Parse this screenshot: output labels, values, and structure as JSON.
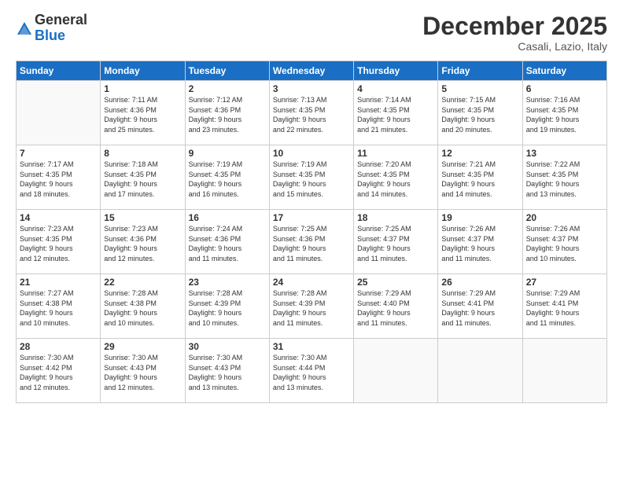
{
  "logo": {
    "general": "General",
    "blue": "Blue"
  },
  "title": "December 2025",
  "location": "Casali, Lazio, Italy",
  "weekdays": [
    "Sunday",
    "Monday",
    "Tuesday",
    "Wednesday",
    "Thursday",
    "Friday",
    "Saturday"
  ],
  "weeks": [
    [
      {
        "day": "",
        "info": ""
      },
      {
        "day": "1",
        "info": "Sunrise: 7:11 AM\nSunset: 4:36 PM\nDaylight: 9 hours\nand 25 minutes."
      },
      {
        "day": "2",
        "info": "Sunrise: 7:12 AM\nSunset: 4:36 PM\nDaylight: 9 hours\nand 23 minutes."
      },
      {
        "day": "3",
        "info": "Sunrise: 7:13 AM\nSunset: 4:35 PM\nDaylight: 9 hours\nand 22 minutes."
      },
      {
        "day": "4",
        "info": "Sunrise: 7:14 AM\nSunset: 4:35 PM\nDaylight: 9 hours\nand 21 minutes."
      },
      {
        "day": "5",
        "info": "Sunrise: 7:15 AM\nSunset: 4:35 PM\nDaylight: 9 hours\nand 20 minutes."
      },
      {
        "day": "6",
        "info": "Sunrise: 7:16 AM\nSunset: 4:35 PM\nDaylight: 9 hours\nand 19 minutes."
      }
    ],
    [
      {
        "day": "7",
        "info": "Sunrise: 7:17 AM\nSunset: 4:35 PM\nDaylight: 9 hours\nand 18 minutes."
      },
      {
        "day": "8",
        "info": "Sunrise: 7:18 AM\nSunset: 4:35 PM\nDaylight: 9 hours\nand 17 minutes."
      },
      {
        "day": "9",
        "info": "Sunrise: 7:19 AM\nSunset: 4:35 PM\nDaylight: 9 hours\nand 16 minutes."
      },
      {
        "day": "10",
        "info": "Sunrise: 7:19 AM\nSunset: 4:35 PM\nDaylight: 9 hours\nand 15 minutes."
      },
      {
        "day": "11",
        "info": "Sunrise: 7:20 AM\nSunset: 4:35 PM\nDaylight: 9 hours\nand 14 minutes."
      },
      {
        "day": "12",
        "info": "Sunrise: 7:21 AM\nSunset: 4:35 PM\nDaylight: 9 hours\nand 14 minutes."
      },
      {
        "day": "13",
        "info": "Sunrise: 7:22 AM\nSunset: 4:35 PM\nDaylight: 9 hours\nand 13 minutes."
      }
    ],
    [
      {
        "day": "14",
        "info": "Sunrise: 7:23 AM\nSunset: 4:35 PM\nDaylight: 9 hours\nand 12 minutes."
      },
      {
        "day": "15",
        "info": "Sunrise: 7:23 AM\nSunset: 4:36 PM\nDaylight: 9 hours\nand 12 minutes."
      },
      {
        "day": "16",
        "info": "Sunrise: 7:24 AM\nSunset: 4:36 PM\nDaylight: 9 hours\nand 11 minutes."
      },
      {
        "day": "17",
        "info": "Sunrise: 7:25 AM\nSunset: 4:36 PM\nDaylight: 9 hours\nand 11 minutes."
      },
      {
        "day": "18",
        "info": "Sunrise: 7:25 AM\nSunset: 4:37 PM\nDaylight: 9 hours\nand 11 minutes."
      },
      {
        "day": "19",
        "info": "Sunrise: 7:26 AM\nSunset: 4:37 PM\nDaylight: 9 hours\nand 11 minutes."
      },
      {
        "day": "20",
        "info": "Sunrise: 7:26 AM\nSunset: 4:37 PM\nDaylight: 9 hours\nand 10 minutes."
      }
    ],
    [
      {
        "day": "21",
        "info": "Sunrise: 7:27 AM\nSunset: 4:38 PM\nDaylight: 9 hours\nand 10 minutes."
      },
      {
        "day": "22",
        "info": "Sunrise: 7:28 AM\nSunset: 4:38 PM\nDaylight: 9 hours\nand 10 minutes."
      },
      {
        "day": "23",
        "info": "Sunrise: 7:28 AM\nSunset: 4:39 PM\nDaylight: 9 hours\nand 10 minutes."
      },
      {
        "day": "24",
        "info": "Sunrise: 7:28 AM\nSunset: 4:39 PM\nDaylight: 9 hours\nand 11 minutes."
      },
      {
        "day": "25",
        "info": "Sunrise: 7:29 AM\nSunset: 4:40 PM\nDaylight: 9 hours\nand 11 minutes."
      },
      {
        "day": "26",
        "info": "Sunrise: 7:29 AM\nSunset: 4:41 PM\nDaylight: 9 hours\nand 11 minutes."
      },
      {
        "day": "27",
        "info": "Sunrise: 7:29 AM\nSunset: 4:41 PM\nDaylight: 9 hours\nand 11 minutes."
      }
    ],
    [
      {
        "day": "28",
        "info": "Sunrise: 7:30 AM\nSunset: 4:42 PM\nDaylight: 9 hours\nand 12 minutes."
      },
      {
        "day": "29",
        "info": "Sunrise: 7:30 AM\nSunset: 4:43 PM\nDaylight: 9 hours\nand 12 minutes."
      },
      {
        "day": "30",
        "info": "Sunrise: 7:30 AM\nSunset: 4:43 PM\nDaylight: 9 hours\nand 13 minutes."
      },
      {
        "day": "31",
        "info": "Sunrise: 7:30 AM\nSunset: 4:44 PM\nDaylight: 9 hours\nand 13 minutes."
      },
      {
        "day": "",
        "info": ""
      },
      {
        "day": "",
        "info": ""
      },
      {
        "day": "",
        "info": ""
      }
    ]
  ]
}
